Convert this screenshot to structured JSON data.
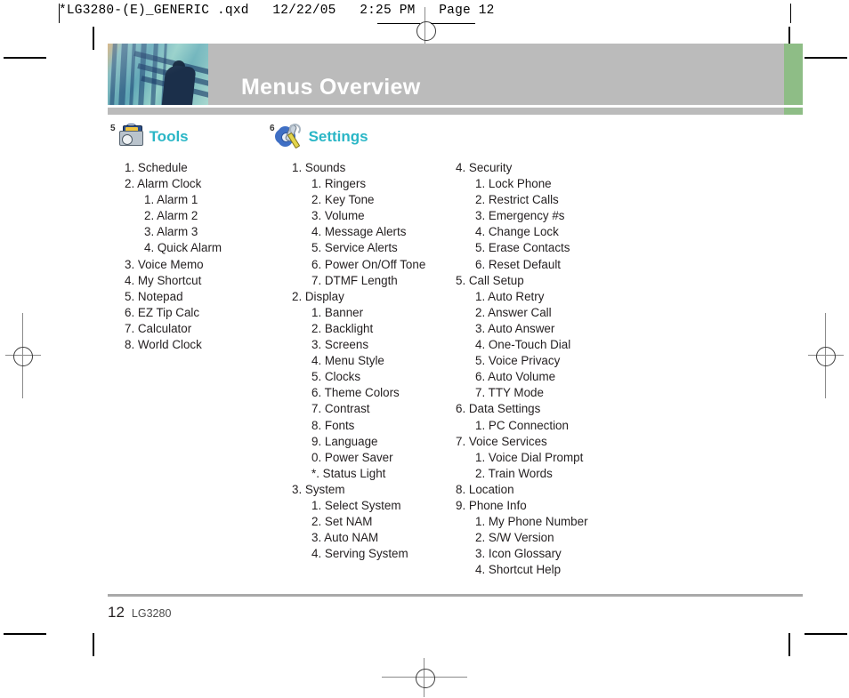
{
  "slug": {
    "text": "*LG3280-(E)_GENERIC .qxd   12/22/05   2:25 PM   Page 12"
  },
  "header": {
    "title": "Menus Overview",
    "photo_alt": "abstract-blue-architecture-photo",
    "band_color": "#bbbbbb",
    "accent_color": "#8ebd86",
    "title_color": "#ffffff"
  },
  "sections": [
    {
      "number": "5",
      "label": "Tools",
      "icon": "toolbox-icon",
      "label_color": "#2ab6c6"
    },
    {
      "number": "6",
      "label": "Settings",
      "icon": "gear-wrench-icon",
      "label_color": "#2ab6c6"
    }
  ],
  "columns": {
    "tools": [
      {
        "level": 1,
        "text": "1. Schedule"
      },
      {
        "level": 1,
        "text": "2. Alarm Clock"
      },
      {
        "level": 2,
        "text": "1. Alarm 1"
      },
      {
        "level": 2,
        "text": "2. Alarm 2"
      },
      {
        "level": 2,
        "text": "3. Alarm 3"
      },
      {
        "level": 2,
        "text": "4. Quick Alarm"
      },
      {
        "level": 1,
        "text": "3. Voice Memo"
      },
      {
        "level": 1,
        "text": "4. My Shortcut"
      },
      {
        "level": 1,
        "text": "5. Notepad"
      },
      {
        "level": 1,
        "text": "6. EZ Tip Calc"
      },
      {
        "level": 1,
        "text": "7. Calculator"
      },
      {
        "level": 1,
        "text": "8. World Clock"
      }
    ],
    "settings_left": [
      {
        "level": 1,
        "text": "1. Sounds"
      },
      {
        "level": 2,
        "text": "1. Ringers"
      },
      {
        "level": 2,
        "text": "2. Key Tone"
      },
      {
        "level": 2,
        "text": "3. Volume"
      },
      {
        "level": 2,
        "text": "4. Message Alerts"
      },
      {
        "level": 2,
        "text": "5. Service Alerts"
      },
      {
        "level": 2,
        "text": "6. Power On/Off Tone"
      },
      {
        "level": 2,
        "text": "7. DTMF Length"
      },
      {
        "level": 1,
        "text": "2. Display"
      },
      {
        "level": 2,
        "text": "1. Banner"
      },
      {
        "level": 2,
        "text": "2. Backlight"
      },
      {
        "level": 2,
        "text": "3. Screens"
      },
      {
        "level": 2,
        "text": "4. Menu Style"
      },
      {
        "level": 2,
        "text": "5. Clocks"
      },
      {
        "level": 2,
        "text": "6. Theme Colors"
      },
      {
        "level": 2,
        "text": "7. Contrast"
      },
      {
        "level": 2,
        "text": "8. Fonts"
      },
      {
        "level": 2,
        "text": "9. Language"
      },
      {
        "level": 2,
        "text": "0. Power Saver"
      },
      {
        "level": 2,
        "text": "*. Status Light"
      },
      {
        "level": 1,
        "text": "3. System"
      },
      {
        "level": 2,
        "text": "1. Select System"
      },
      {
        "level": 2,
        "text": "2. Set NAM"
      },
      {
        "level": 2,
        "text": "3. Auto NAM"
      },
      {
        "level": 2,
        "text": "4. Serving System"
      }
    ],
    "settings_right": [
      {
        "level": 1,
        "text": "4. Security"
      },
      {
        "level": 2,
        "text": "1. Lock Phone"
      },
      {
        "level": 2,
        "text": "2. Restrict Calls"
      },
      {
        "level": 2,
        "text": "3. Emergency #s"
      },
      {
        "level": 2,
        "text": "4. Change Lock"
      },
      {
        "level": 2,
        "text": "5. Erase Contacts"
      },
      {
        "level": 2,
        "text": "6. Reset Default"
      },
      {
        "level": 1,
        "text": "5. Call Setup"
      },
      {
        "level": 2,
        "text": "1. Auto Retry"
      },
      {
        "level": 2,
        "text": "2. Answer Call"
      },
      {
        "level": 2,
        "text": "3. Auto Answer"
      },
      {
        "level": 2,
        "text": "4. One-Touch Dial"
      },
      {
        "level": 2,
        "text": "5. Voice Privacy"
      },
      {
        "level": 2,
        "text": "6. Auto Volume"
      },
      {
        "level": 2,
        "text": "7. TTY Mode"
      },
      {
        "level": 1,
        "text": "6. Data Settings"
      },
      {
        "level": 2,
        "text": "1. PC Connection"
      },
      {
        "level": 1,
        "text": "7. Voice Services"
      },
      {
        "level": 2,
        "text": "1. Voice Dial Prompt"
      },
      {
        "level": 2,
        "text": "2. Train Words"
      },
      {
        "level": 1,
        "text": "8. Location"
      },
      {
        "level": 1,
        "text": "9. Phone Info"
      },
      {
        "level": 2,
        "text": "1. My Phone Number"
      },
      {
        "level": 2,
        "text": "2. S/W Version"
      },
      {
        "level": 2,
        "text": "3. Icon Glossary"
      },
      {
        "level": 2,
        "text": "4. Shortcut Help"
      }
    ]
  },
  "footer": {
    "page_number": "12",
    "model": "LG3280"
  }
}
